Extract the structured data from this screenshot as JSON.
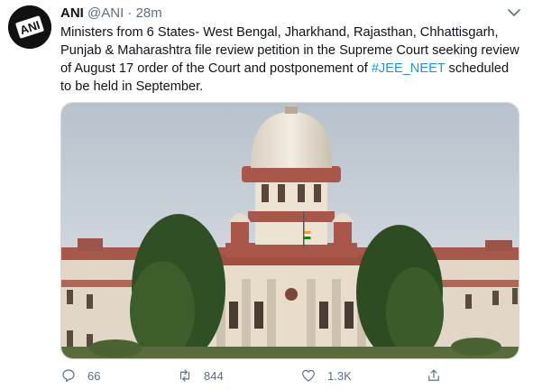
{
  "tweet": {
    "author_name": "ANI",
    "handle": "@ANI",
    "separator": "·",
    "time": "28m",
    "avatar_text": "ANI",
    "text_main": "Ministers from 6 States- West Bengal, Jharkhand, Rajasthan, Chhattisgarh, Punjab & Maharashtra file review petition in the Supreme Court seeking review of August 17 order of the Court and postponement of ",
    "hashtag": "#JEE_NEET",
    "text_end": " scheduled to be held in September.",
    "media_icon": "supreme-court-photo"
  },
  "actions": {
    "reply_count": "66",
    "retweet_count": "844",
    "like_count": "1.3K"
  },
  "colors": {
    "link": "#1b95e0",
    "secondary_text": "#5b7083",
    "primary_text": "#0f1419"
  }
}
